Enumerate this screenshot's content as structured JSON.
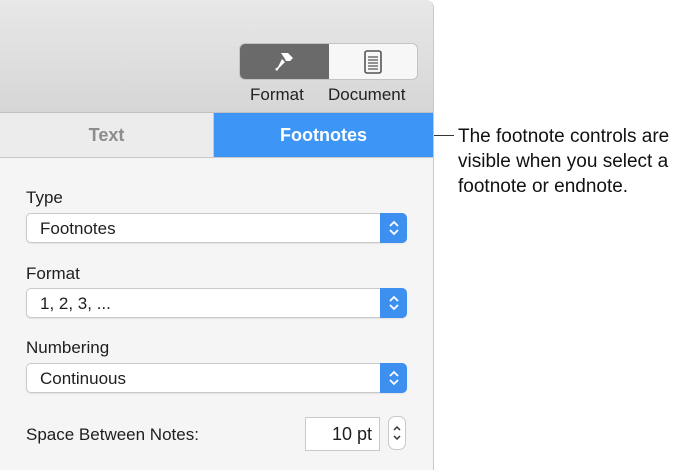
{
  "toolbar": {
    "format_label": "Format",
    "document_label": "Document",
    "active": "Format"
  },
  "tabs": [
    {
      "label": "Text",
      "active": false
    },
    {
      "label": "Footnotes",
      "active": true
    }
  ],
  "type": {
    "label": "Type",
    "value": "Footnotes"
  },
  "format": {
    "label": "Format",
    "value": "1, 2, 3, ..."
  },
  "numbering": {
    "label": "Numbering",
    "value": "Continuous"
  },
  "spacing": {
    "label": "Space Between Notes:",
    "value": "10 pt"
  },
  "callout": "The footnote controls are visible when you select a footnote or endnote.",
  "colors": {
    "accent": "#3d95f5",
    "active_segment": "#6a6a6a"
  }
}
